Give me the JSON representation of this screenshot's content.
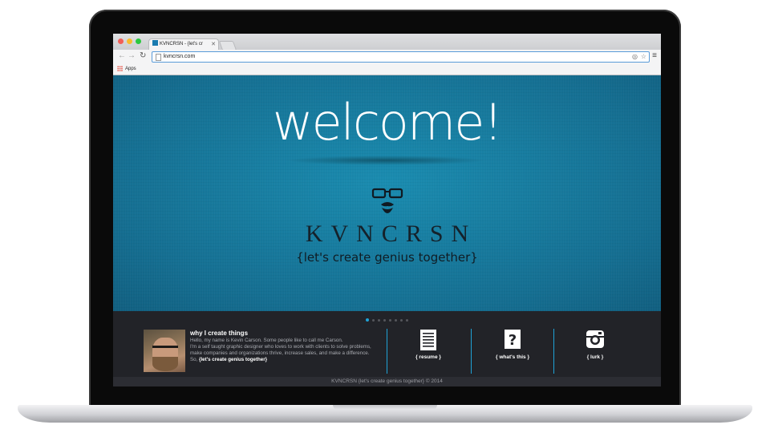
{
  "browser": {
    "tab_title": "KVNCRSN - {let's cr",
    "tab_close": "✕",
    "url": "kvncrsn.com",
    "bookmarks_apps": "Apps"
  },
  "hero": {
    "headline": "welcome!",
    "brand": "KVNCRSN",
    "tagline": "{let's create genius together}"
  },
  "about": {
    "title": "why I create things",
    "lines": [
      "Hello, my name is Kevin Carson. Some people like to call me Carson.",
      "I'm a self taught graphic designer who loves to work with clients to solve problems,",
      "make companies and organizations thrive, increase sales, and make a difference.",
      "So,"
    ],
    "cta": "{let's create genius together}"
  },
  "features": [
    {
      "label": "{ resume }",
      "icon": "document-icon"
    },
    {
      "label": "{ what's this }",
      "icon": "question-icon"
    },
    {
      "label": "{ lurk }",
      "icon": "instagram-icon"
    }
  ],
  "pager": {
    "count": 8,
    "active": 0
  },
  "footer": "KVNCRSN {let's create genius together} © 2014",
  "colors": {
    "hero": "#156f92",
    "accent": "#1fa2d6",
    "panel": "#222328"
  }
}
